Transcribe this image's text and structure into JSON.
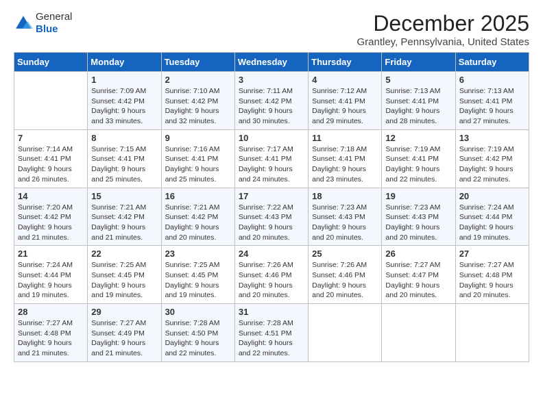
{
  "logo": {
    "line1": "General",
    "line2": "Blue"
  },
  "title": "December 2025",
  "location": "Grantley, Pennsylvania, United States",
  "days_of_week": [
    "Sunday",
    "Monday",
    "Tuesday",
    "Wednesday",
    "Thursday",
    "Friday",
    "Saturday"
  ],
  "weeks": [
    [
      {
        "day": "",
        "sunrise": "",
        "sunset": "",
        "daylight": ""
      },
      {
        "day": "1",
        "sunrise": "Sunrise: 7:09 AM",
        "sunset": "Sunset: 4:42 PM",
        "daylight": "Daylight: 9 hours and 33 minutes."
      },
      {
        "day": "2",
        "sunrise": "Sunrise: 7:10 AM",
        "sunset": "Sunset: 4:42 PM",
        "daylight": "Daylight: 9 hours and 32 minutes."
      },
      {
        "day": "3",
        "sunrise": "Sunrise: 7:11 AM",
        "sunset": "Sunset: 4:42 PM",
        "daylight": "Daylight: 9 hours and 30 minutes."
      },
      {
        "day": "4",
        "sunrise": "Sunrise: 7:12 AM",
        "sunset": "Sunset: 4:41 PM",
        "daylight": "Daylight: 9 hours and 29 minutes."
      },
      {
        "day": "5",
        "sunrise": "Sunrise: 7:13 AM",
        "sunset": "Sunset: 4:41 PM",
        "daylight": "Daylight: 9 hours and 28 minutes."
      },
      {
        "day": "6",
        "sunrise": "Sunrise: 7:13 AM",
        "sunset": "Sunset: 4:41 PM",
        "daylight": "Daylight: 9 hours and 27 minutes."
      }
    ],
    [
      {
        "day": "7",
        "sunrise": "Sunrise: 7:14 AM",
        "sunset": "Sunset: 4:41 PM",
        "daylight": "Daylight: 9 hours and 26 minutes."
      },
      {
        "day": "8",
        "sunrise": "Sunrise: 7:15 AM",
        "sunset": "Sunset: 4:41 PM",
        "daylight": "Daylight: 9 hours and 25 minutes."
      },
      {
        "day": "9",
        "sunrise": "Sunrise: 7:16 AM",
        "sunset": "Sunset: 4:41 PM",
        "daylight": "Daylight: 9 hours and 25 minutes."
      },
      {
        "day": "10",
        "sunrise": "Sunrise: 7:17 AM",
        "sunset": "Sunset: 4:41 PM",
        "daylight": "Daylight: 9 hours and 24 minutes."
      },
      {
        "day": "11",
        "sunrise": "Sunrise: 7:18 AM",
        "sunset": "Sunset: 4:41 PM",
        "daylight": "Daylight: 9 hours and 23 minutes."
      },
      {
        "day": "12",
        "sunrise": "Sunrise: 7:19 AM",
        "sunset": "Sunset: 4:41 PM",
        "daylight": "Daylight: 9 hours and 22 minutes."
      },
      {
        "day": "13",
        "sunrise": "Sunrise: 7:19 AM",
        "sunset": "Sunset: 4:42 PM",
        "daylight": "Daylight: 9 hours and 22 minutes."
      }
    ],
    [
      {
        "day": "14",
        "sunrise": "Sunrise: 7:20 AM",
        "sunset": "Sunset: 4:42 PM",
        "daylight": "Daylight: 9 hours and 21 minutes."
      },
      {
        "day": "15",
        "sunrise": "Sunrise: 7:21 AM",
        "sunset": "Sunset: 4:42 PM",
        "daylight": "Daylight: 9 hours and 21 minutes."
      },
      {
        "day": "16",
        "sunrise": "Sunrise: 7:21 AM",
        "sunset": "Sunset: 4:42 PM",
        "daylight": "Daylight: 9 hours and 20 minutes."
      },
      {
        "day": "17",
        "sunrise": "Sunrise: 7:22 AM",
        "sunset": "Sunset: 4:43 PM",
        "daylight": "Daylight: 9 hours and 20 minutes."
      },
      {
        "day": "18",
        "sunrise": "Sunrise: 7:23 AM",
        "sunset": "Sunset: 4:43 PM",
        "daylight": "Daylight: 9 hours and 20 minutes."
      },
      {
        "day": "19",
        "sunrise": "Sunrise: 7:23 AM",
        "sunset": "Sunset: 4:43 PM",
        "daylight": "Daylight: 9 hours and 20 minutes."
      },
      {
        "day": "20",
        "sunrise": "Sunrise: 7:24 AM",
        "sunset": "Sunset: 4:44 PM",
        "daylight": "Daylight: 9 hours and 19 minutes."
      }
    ],
    [
      {
        "day": "21",
        "sunrise": "Sunrise: 7:24 AM",
        "sunset": "Sunset: 4:44 PM",
        "daylight": "Daylight: 9 hours and 19 minutes."
      },
      {
        "day": "22",
        "sunrise": "Sunrise: 7:25 AM",
        "sunset": "Sunset: 4:45 PM",
        "daylight": "Daylight: 9 hours and 19 minutes."
      },
      {
        "day": "23",
        "sunrise": "Sunrise: 7:25 AM",
        "sunset": "Sunset: 4:45 PM",
        "daylight": "Daylight: 9 hours and 19 minutes."
      },
      {
        "day": "24",
        "sunrise": "Sunrise: 7:26 AM",
        "sunset": "Sunset: 4:46 PM",
        "daylight": "Daylight: 9 hours and 20 minutes."
      },
      {
        "day": "25",
        "sunrise": "Sunrise: 7:26 AM",
        "sunset": "Sunset: 4:46 PM",
        "daylight": "Daylight: 9 hours and 20 minutes."
      },
      {
        "day": "26",
        "sunrise": "Sunrise: 7:27 AM",
        "sunset": "Sunset: 4:47 PM",
        "daylight": "Daylight: 9 hours and 20 minutes."
      },
      {
        "day": "27",
        "sunrise": "Sunrise: 7:27 AM",
        "sunset": "Sunset: 4:48 PM",
        "daylight": "Daylight: 9 hours and 20 minutes."
      }
    ],
    [
      {
        "day": "28",
        "sunrise": "Sunrise: 7:27 AM",
        "sunset": "Sunset: 4:48 PM",
        "daylight": "Daylight: 9 hours and 21 minutes."
      },
      {
        "day": "29",
        "sunrise": "Sunrise: 7:27 AM",
        "sunset": "Sunset: 4:49 PM",
        "daylight": "Daylight: 9 hours and 21 minutes."
      },
      {
        "day": "30",
        "sunrise": "Sunrise: 7:28 AM",
        "sunset": "Sunset: 4:50 PM",
        "daylight": "Daylight: 9 hours and 22 minutes."
      },
      {
        "day": "31",
        "sunrise": "Sunrise: 7:28 AM",
        "sunset": "Sunset: 4:51 PM",
        "daylight": "Daylight: 9 hours and 22 minutes."
      },
      {
        "day": "",
        "sunrise": "",
        "sunset": "",
        "daylight": ""
      },
      {
        "day": "",
        "sunrise": "",
        "sunset": "",
        "daylight": ""
      },
      {
        "day": "",
        "sunrise": "",
        "sunset": "",
        "daylight": ""
      }
    ]
  ]
}
